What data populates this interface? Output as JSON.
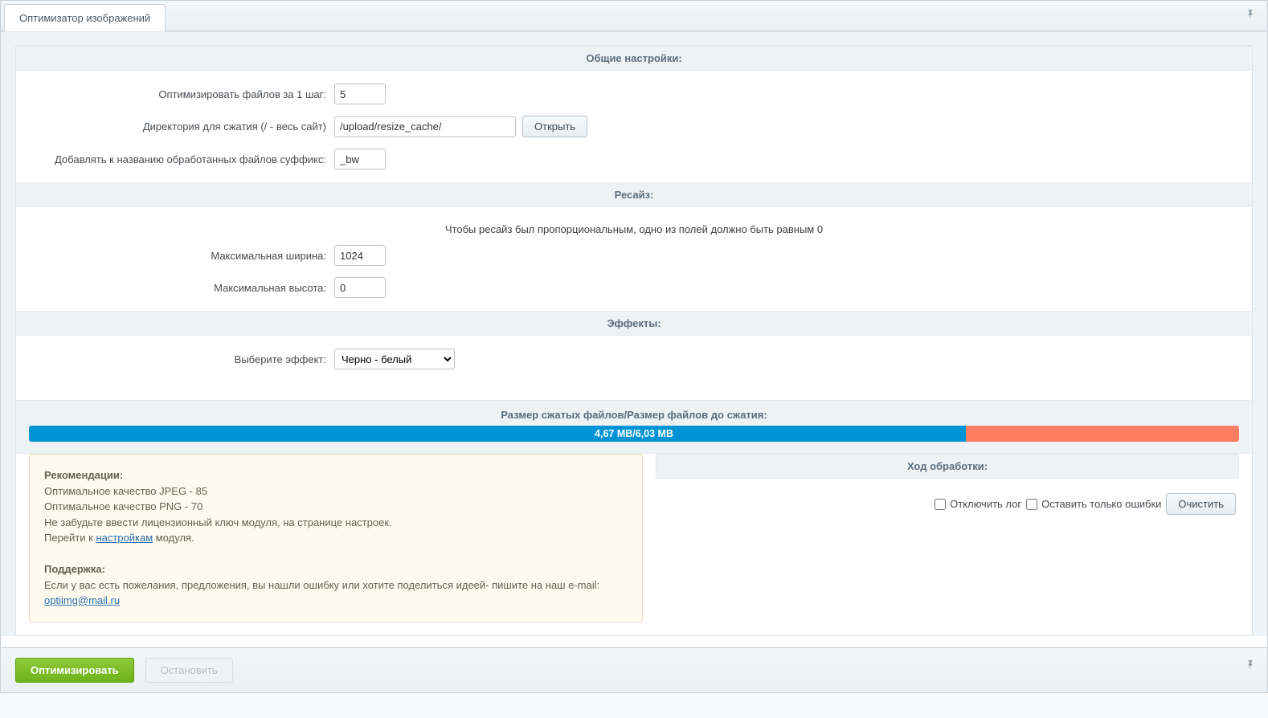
{
  "tab": {
    "title": "Оптимизатор изображений"
  },
  "sections": {
    "general": {
      "title": "Общие настройки:",
      "files_per_step_label": "Оптимизировать файлов за 1 шаг:",
      "files_per_step_value": "5",
      "directory_label": "Директория для сжатия (/ - весь сайт)",
      "directory_value": "/upload/resize_cache/",
      "open_label": "Открыть",
      "suffix_label": "Добавлять к названию обработанных файлов суффикс:",
      "suffix_value": "_bw"
    },
    "resize": {
      "title": "Ресайз:",
      "note": "Чтобы ресайз был пропорциональным, одно из полей должно быть равным 0",
      "max_width_label": "Максимальная ширина:",
      "max_width_value": "1024",
      "max_height_label": "Максимальная высота:",
      "max_height_value": "0"
    },
    "effects": {
      "title": "Эффекты:",
      "select_label": "Выберите эффект:",
      "select_value": "Черно - белый"
    },
    "progress": {
      "title": "Размер сжатых файлов/Размер файлов до сжатия:",
      "value_text": "4,67 MB/6,03 MB",
      "percent": 77.4
    }
  },
  "recommendations": {
    "title": "Рекомендации:",
    "jpeg_line": "Оптимальное качество JPEG - 85",
    "png_line": "Оптимальное качество PNG - 70",
    "license_line": "Не забудьте ввести лицензионный ключ модуля, на странице настроек.",
    "goto_prefix": "Перейти к ",
    "goto_link": "настройкам",
    "goto_suffix": " модуля.",
    "support_title": "Поддержка:",
    "support_line": "Если у вас есть пожелания, предложения, вы нашли ошибку или хотите поделиться идеей- пишите на наш e-mail:",
    "support_email": "optiimg@mail.ru"
  },
  "log": {
    "title": "Ход обработки:",
    "disable_log_label": "Отключить лог",
    "errors_only_label": "Оставить только ошибки",
    "clear_label": "Очистить"
  },
  "footer": {
    "optimize_label": "Оптимизировать",
    "stop_label": "Остановить"
  }
}
